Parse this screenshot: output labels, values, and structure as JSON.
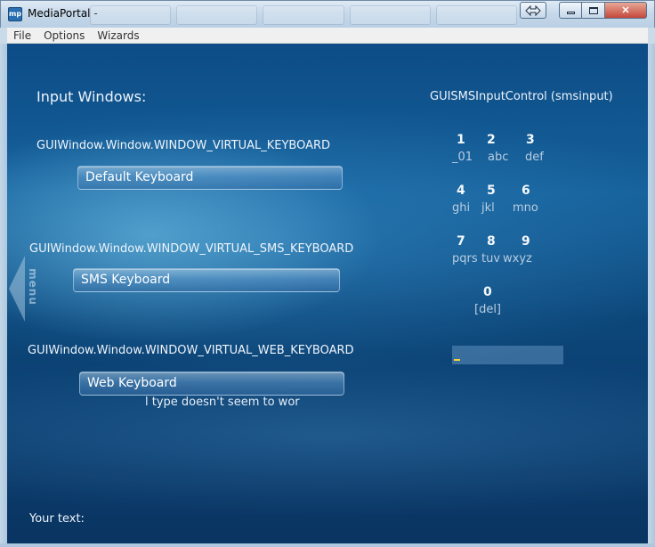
{
  "window": {
    "title": "MediaPortal -",
    "controls": {
      "close_glyph": "✕"
    }
  },
  "menubar": {
    "items": [
      "File",
      "Options",
      "Wizards"
    ]
  },
  "content": {
    "heading": "Input Windows:",
    "right_title": "GUISMSInputControl (smsinput)",
    "sections": [
      {
        "caption": "GUIWindow.Window.WINDOW_VIRTUAL_KEYBOARD",
        "button": "Default Keyboard"
      },
      {
        "caption": "GUIWindow.Window.WINDOW_VIRTUAL_SMS_KEYBOARD",
        "button": "SMS Keyboard"
      },
      {
        "caption": "GUIWindow.Window.WINDOW_VIRTUAL_WEB_KEYBOARD",
        "button": "Web Keyboard"
      }
    ],
    "scrolling_text": "l type doesn't seem to wor",
    "menu_tab_label": "menu",
    "your_text_label": "Your text:",
    "keypad": [
      {
        "digit": "1",
        "letters": "_01"
      },
      {
        "digit": "2",
        "letters": "abc"
      },
      {
        "digit": "3",
        "letters": "def"
      },
      {
        "digit": "4",
        "letters": "ghi"
      },
      {
        "digit": "5",
        "letters": "jkl"
      },
      {
        "digit": "6",
        "letters": "mno"
      },
      {
        "digit": "7",
        "letters": "pqrs"
      },
      {
        "digit": "8",
        "letters": "tuv"
      },
      {
        "digit": "9",
        "letters": "wxyz"
      },
      {
        "digit": "0",
        "letters": "[del]"
      }
    ],
    "sms_input_value": ""
  },
  "colors": {
    "background": "#0d4c86",
    "caret": "#f3d33a"
  }
}
